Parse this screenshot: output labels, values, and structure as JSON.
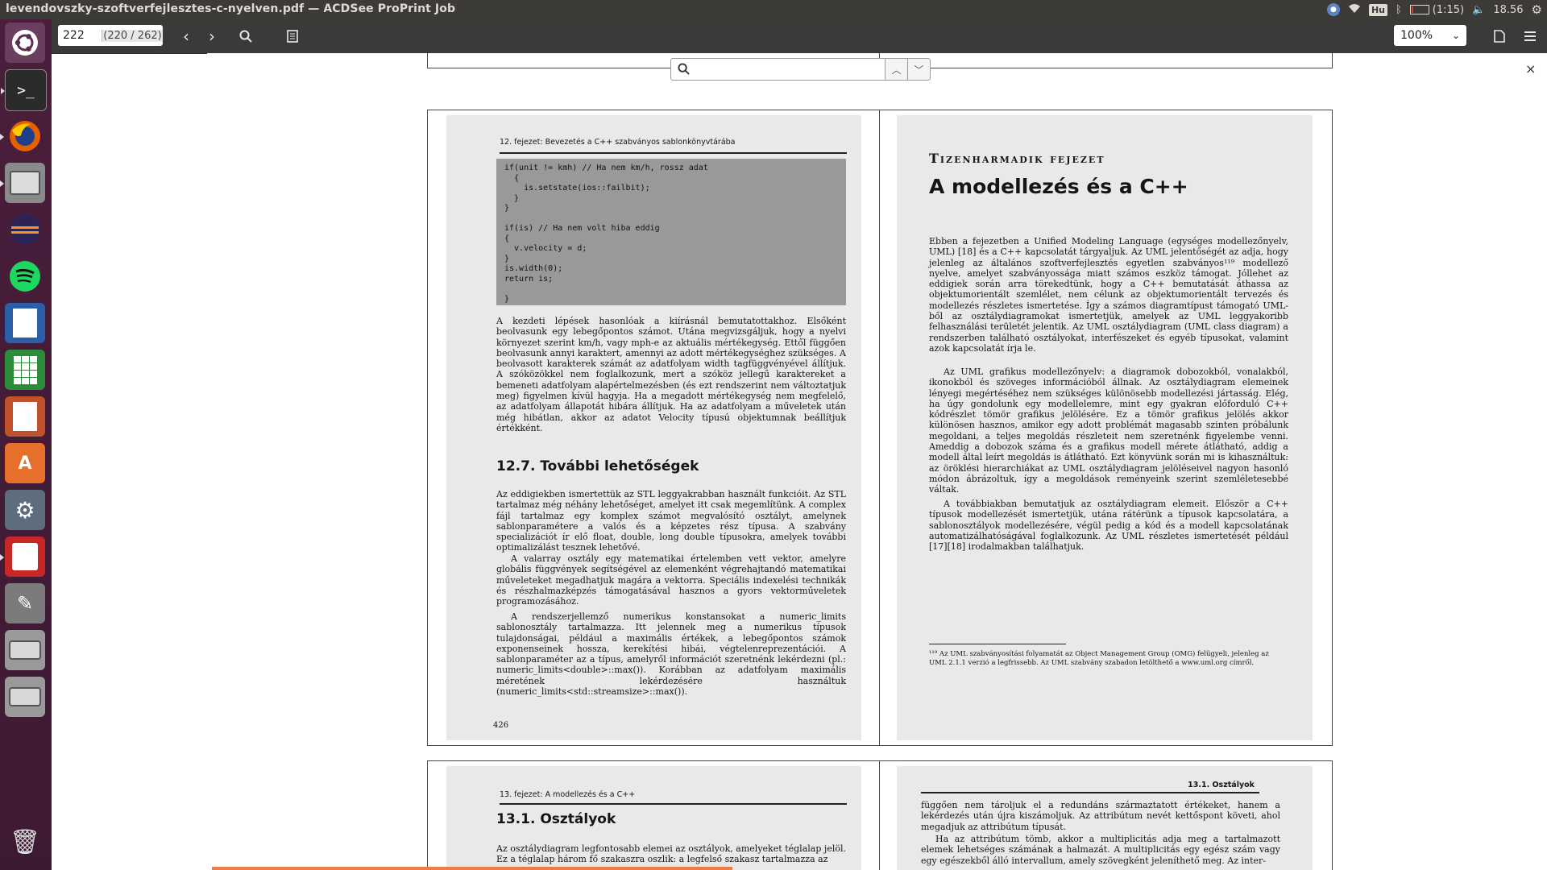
{
  "window": {
    "title": "levendovszky-szoftverfejlesztes-c-nyelven.pdf — ACDSee ProPrint Job"
  },
  "tray": {
    "keyboard": "Hu",
    "battery": "(1:15)",
    "battery_level": 0.1,
    "clock": "18.56",
    "icons": [
      "chat-icon",
      "wifi-icon",
      "bluetooth-icon",
      "battery-icon",
      "volume-icon",
      "settings-gear-icon"
    ]
  },
  "launcher": {
    "items": [
      "ubuntu-dash",
      "terminal",
      "firefox",
      "files",
      "eclipse",
      "spotify",
      "writer",
      "calc",
      "impress",
      "software-center",
      "system-settings",
      "document-viewer",
      "text-editor",
      "disk-1",
      "disk-2",
      "trash"
    ]
  },
  "toolbar": {
    "page_current": "222",
    "page_count": "(220 / 262)",
    "zoom": "100%"
  },
  "search": {
    "placeholder": ""
  },
  "document": {
    "left_page": {
      "header": "12. fejezet: Bevezetés a C++ szabványos sablonkönyvtárába",
      "code": "if(unit != kmh) // Ha nem km/h, rossz adat\n  {\n    is.setstate(ios::failbit);\n  }\n}\n\nif(is) // Ha nem volt hiba eddig\n{\n  v.velocity = d;\n}\nis.width(0);\nreturn is;\n\n}",
      "para1": "A kezdeti lépések hasonlóak a kiírásnál bemutatottakhoz. Elsőként beolvasunk egy lebegőpontos számot. Utána megvizsgáljuk, hogy a nyelvi környezet szerint km/h, vagy mph-e az aktuális mértékegység. Ettől függően beolvasunk annyi karaktert, amennyi az adott mértékegységhez szükséges. A beolvasott karakterek számát az adatfolyam width tagfüggvényével állítjuk. A szóközökkel nem foglalkozunk, mert a szóköz jellegű karaktereket a bemeneti adatfolyam alapértelmezésben (és ezt rendszerint nem változtatjuk meg) figyelmen kívül hagyja. Ha a megadott mértékegység nem megfelelő, az adatfolyam állapotát hibára állítjuk. Ha az adatfolyam a műveletek után még hibátlan, akkor az adatot Velocity típusú objektumnak beállítjuk értékként.",
      "section": "12.7. További lehetőségek",
      "para2": "Az eddigiekben ismertettük az STL leggyakrabban használt funkcióit. Az STL tartalmaz még néhány lehetőséget, amelyet itt csak megemlítünk. A complex fájl tartalmaz egy komplex számot megvalósító osztályt, amelynek sablonparamétere a valós és a képzetes rész típusa. A szabvány specializációt ír elő float, double, long double típusokra, amelyek további optimalizálást tesznek lehetővé.",
      "para3": "A valarray osztály egy matematikai értelemben vett vektor, amelyre globális függvények segítségével az elemenként végrehajtandó matematikai műveleteket megadhatjuk magára a vektorra. Speciális indexelési technikák és részhalmazképzés támogatásával hasznos a gyors vektorműveletek programozásához.",
      "para4": "A rendszerjellemző numerikus konstansokat a numeric_limits sablonosztály tartalmazza. Itt jelennek meg a numerikus típusok tulajdonságai, például a maximális értékek, a lebegőpontos számok exponenseinek hossza, kerekítési hibái, végtelenreprezentációi. A sablonparaméter az a típus, amelyről információt szeretnénk lekérdezni (pl.: numeric_limits<double>::max()). Korábban az adatfolyam maximális méretének lekérdezésére használtuk (numeric_limits<std::streamsize>::max()).",
      "page_number": "426"
    },
    "right_page": {
      "kicker": "Tizenharmadik fejezet",
      "title": "A modellezés és a C++",
      "para1": "Ebben a fejezetben a Unified Modeling Language (egységes modellezőnyelv, UML) [18] és a C++ kapcsolatát tárgyaljuk. Az UML jelentőségét az adja, hogy jelenleg az általános szoftverfejlesztés egyetlen szabványos¹¹⁹ modellező nyelve, amelyet szabványossága miatt számos eszköz támogat. Jóllehet az eddigiek során arra törekedtünk, hogy a C++ bemutatását áthassa az objektumorientált szemlélet, nem célunk az objektumorientált tervezés és modellezés részletes ismertetése. Így a számos diagramtípust támogató UML-ből az osztálydiagramokat ismertetjük, amelyek az UML leggyakoribb felhasználási területét jelentik. Az UML osztálydiagram (UML class diagram) a rendszerben található osztályokat, interfészeket és egyéb típusokat, valamint azok kapcsolatát írja le.",
      "para2": "Az UML grafikus modellezőnyelv: a diagramok dobozokból, vonalakból, ikonokból és szöveges információból állnak. Az osztálydiagram elemeinek lényegi megértéséhez nem szükséges különösebb modellezési jártasság. Elég, ha úgy gondolunk egy modellelemre, mint egy gyakran előforduló C++ kódrészlet tömör grafikus jelölésére. Ez a tömör grafikus jelölés akkor különösen hasznos, amikor egy adott problémát magasabb szinten próbálunk megoldani, a teljes megoldás részleteit nem szeretnénk figyelembe venni. Ameddig a dobozok száma és a grafikus modell mérete átlátható, addig a modell által leírt megoldás is átlátható. Ezt könyvünk során mi is kihasználtuk: az öröklési hierarchiákat az UML osztálydiagram jelöléseivel nagyon hasonló módon ábrázoltuk, így a megoldások reményeink szerint szemléletesebbé váltak.",
      "para3": "A továbbiakban bemutatjuk az osztálydiagram elemeit. Először a C++ típusok modellezését ismertetjük, utána rátérünk a típusok kapcsolatára, a sablonosztályok modellezésére, végül pedig a kód és a modell kapcsolatának automatizálhatóságával foglalkozunk. Az UML részletes ismertetését például [17][18] irodalmakban találhatjuk.",
      "footnote": "¹¹⁹ Az UML szabványosítási folyamatát az Object Management Group (OMG) felügyeli, jelenleg az UML 2.1.1 verzió a legfrissebb. Az UML szabvány szabadon letölthető a www.uml.org címről."
    },
    "next_left": {
      "header": "13. fejezet: A modellezés és a C++",
      "section": "13.1. Osztályok",
      "para": "Az osztálydiagram legfontosabb elemei az osztályok, amelyeket téglalap jelöl. Ez a téglalap három fő szakaszra oszlik: a legfelső szakasz tartalmazza az"
    },
    "next_right": {
      "header": "13.1. Osztályok",
      "para1": "függően nem tároljuk el a redundáns származtatott értékeket, hanem a lekérdezés után újra kiszámoljuk. Az attribútum nevét kettőspont követi, ahol megadjuk az attribútum típusát.",
      "para2": "Ha az attribútum tömb, akkor a multiplicitás adja meg a tartalmazott elemek lehetséges számának a halmazát. A multiplicitás egy egész szám vagy egy egészekből álló intervallum, amely szövegként jeleníthető meg. Az inter-"
    }
  },
  "progress": {
    "fraction": 0.39
  }
}
